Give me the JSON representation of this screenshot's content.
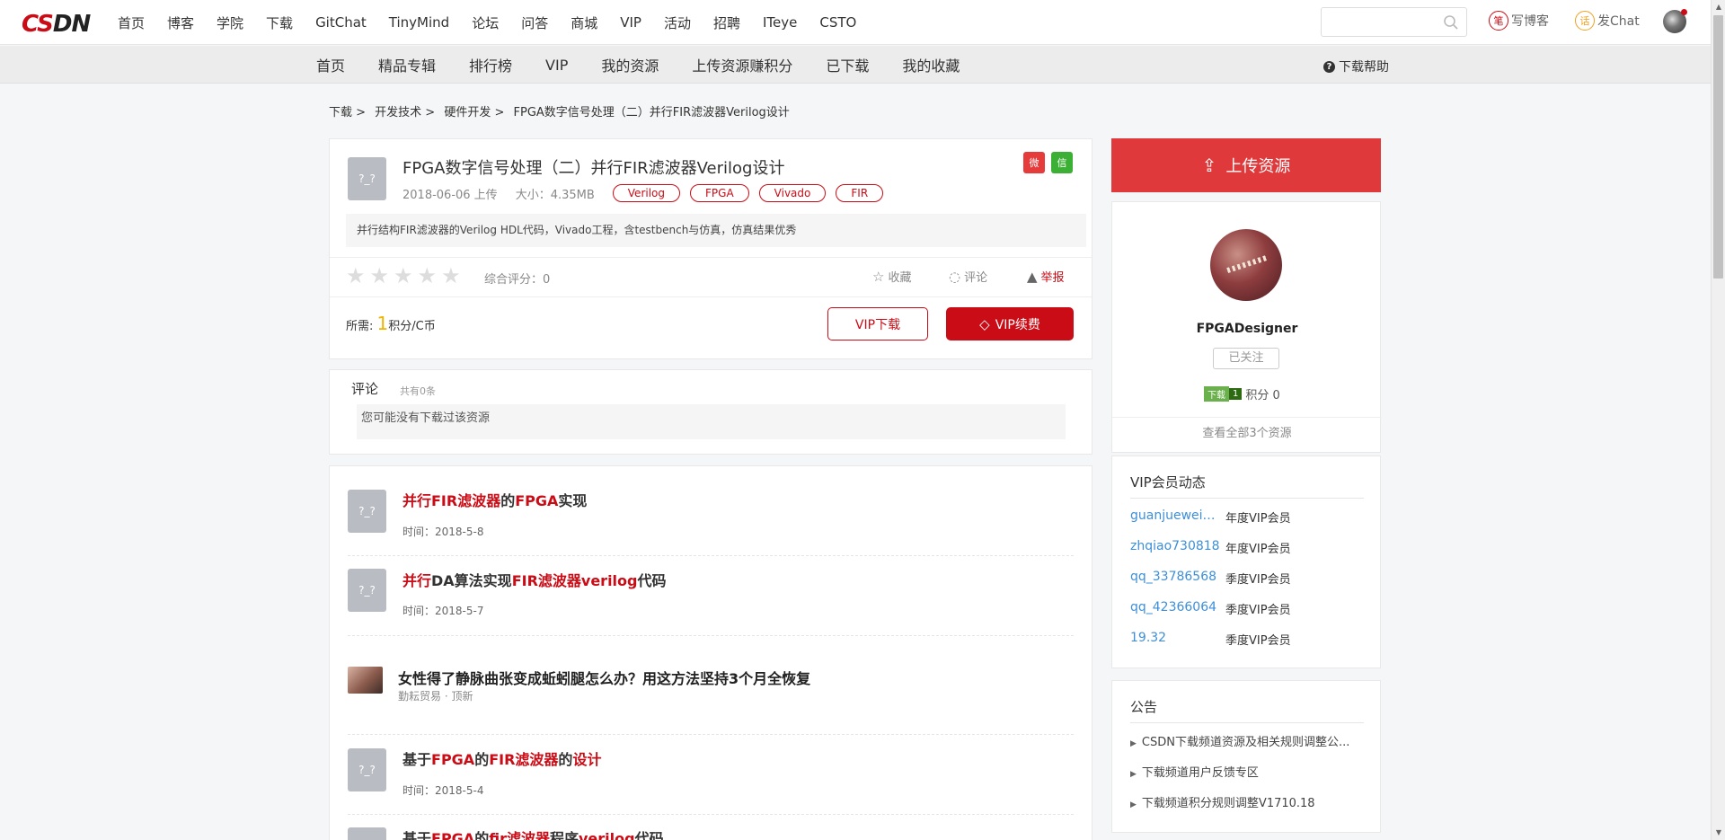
{
  "logo": {
    "c": "CS",
    "rest": "DN"
  },
  "topnav": [
    "首页",
    "博客",
    "学院",
    "下载",
    "GitChat",
    "TinyMind",
    "论坛",
    "问答",
    "商城",
    "VIP",
    "活动",
    "招聘",
    "ITeye",
    "CSTO"
  ],
  "search": {
    "placeholder": ""
  },
  "header": {
    "write_blog": "写博客",
    "write_icon": "笔",
    "post_chat": "发Chat",
    "chat_icon": "话"
  },
  "subnav": [
    "首页",
    "精品专辑",
    "排行榜",
    "VIP",
    "我的资源",
    "上传资源赚积分",
    "已下载",
    "我的收藏"
  ],
  "help": {
    "icon": "?",
    "label": "下载帮助"
  },
  "breadcrumb": [
    "下载 >",
    "开发技术 >",
    "硬件开发 >",
    "FPGA数字信号处理（二）并行FIR滤波器Verilog设计"
  ],
  "resource": {
    "icon_text": "?_?",
    "title": "FPGA数字信号处理（二）并行FIR滤波器Verilog设计",
    "date": "2018-06-06 上传",
    "size": "大小：4.35MB",
    "tags": [
      "Verilog",
      "FPGA",
      "Vivado",
      "FIR"
    ],
    "share_icons": [
      "weibo-icon",
      "wechat-icon"
    ],
    "description": "并行结构FIR滤波器的Verilog HDL代码，Vivado工程，含testbench与仿真，仿真结果优秀",
    "stars": [
      "★",
      "★",
      "★",
      "★",
      "★"
    ],
    "rating": 0,
    "score_label": "综合评分：0",
    "collect": "收藏",
    "comment": "评论",
    "report": "举报",
    "collect_icon": "☆",
    "comment_icon": "◌",
    "report_icon": "▲",
    "need_prefix": "所需: ",
    "need_num": "1",
    "need_suffix": "积分/C币",
    "vip_download": "VIP下载",
    "vip_renew": "VIP续费",
    "vip_icon": "◇"
  },
  "comments": {
    "title": "评论",
    "count": "共有0条",
    "empty": "您可能没有下载过该资源"
  },
  "related": [
    {
      "parts": [
        {
          "t": "并行FIR滤波器",
          "hl": true
        },
        {
          "t": "的",
          "hl": false
        },
        {
          "t": "FPGA",
          "hl": true
        },
        {
          "t": "实现",
          "hl": false
        }
      ],
      "time": "时间：2018-5-8"
    },
    {
      "parts": [
        {
          "t": "并行",
          "hl": true
        },
        {
          "t": "DA算法实现",
          "hl": false
        },
        {
          "t": "FIR滤波器verilog",
          "hl": true
        },
        {
          "t": "代码",
          "hl": false
        }
      ],
      "time": "时间：2018-5-7"
    },
    {
      "parts": [
        {
          "t": "基于",
          "hl": false
        },
        {
          "t": "FPGA",
          "hl": true
        },
        {
          "t": "的",
          "hl": false
        },
        {
          "t": "FIR滤波器",
          "hl": true
        },
        {
          "t": "的",
          "hl": false
        },
        {
          "t": "设计",
          "hl": true
        }
      ],
      "time": "时间：2018-5-4"
    },
    {
      "parts": [
        {
          "t": "基于",
          "hl": false
        },
        {
          "t": "FPGA",
          "hl": true
        },
        {
          "t": "的",
          "hl": false
        },
        {
          "t": "fir滤波器",
          "hl": true
        },
        {
          "t": "程序",
          "hl": false
        },
        {
          "t": "verilog",
          "hl": true
        },
        {
          "t": "代码",
          "hl": false
        }
      ],
      "time": ""
    }
  ],
  "ad": {
    "title": "女性得了静脉曲张变成蚯蚓腿怎么办？用这方法坚持3个月全恢复",
    "source": "勤耘贸易 · 顶新"
  },
  "sidebar": {
    "upload": "上传资源",
    "upload_icon": "⇪",
    "author": {
      "name": "FPGADesigner",
      "follow": "已关注",
      "badge_label": "下载",
      "badge_level": "1",
      "points": "积分 0",
      "view_all": "查看全部3个资源"
    },
    "vip_title": "VIP会员动态",
    "vip_members": [
      {
        "name": "guanjueweim...",
        "type": "年度VIP会员"
      },
      {
        "name": "zhqiao730818",
        "type": "年度VIP会员"
      },
      {
        "name": "qq_33786568",
        "type": "季度VIP会员"
      },
      {
        "name": "qq_42366064",
        "type": "季度VIP会员"
      },
      {
        "name": "19.32",
        "type": "季度VIP会员"
      }
    ],
    "notice_title": "公告",
    "notices": [
      "CSDN下载频道资源及相关规则调整公...",
      "下载频道用户反馈专区",
      "下载频道积分规则调整V1710.18"
    ]
  },
  "colors": {
    "brand": "#ca0c16",
    "upload": "#e0393b",
    "link": "#3e8fd8"
  }
}
